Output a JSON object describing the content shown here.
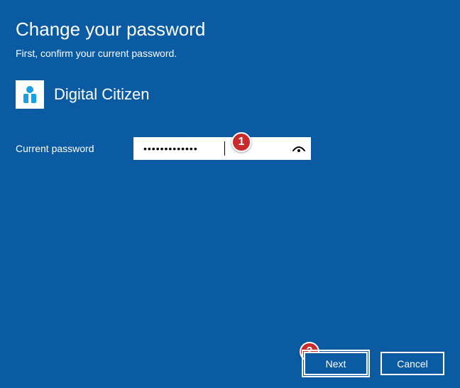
{
  "title": "Change your password",
  "subtitle": "First, confirm your current password.",
  "user": {
    "name": "Digital Citizen"
  },
  "field": {
    "label": "Current password",
    "value": "•••••••••••••",
    "reveal_icon": "password-reveal-icon"
  },
  "callouts": {
    "one": "1",
    "two": "2"
  },
  "buttons": {
    "next": "Next",
    "cancel": "Cancel"
  },
  "colors": {
    "background": "#0b5ba3",
    "callout": "#c72b2b",
    "text": "#ffffff"
  }
}
